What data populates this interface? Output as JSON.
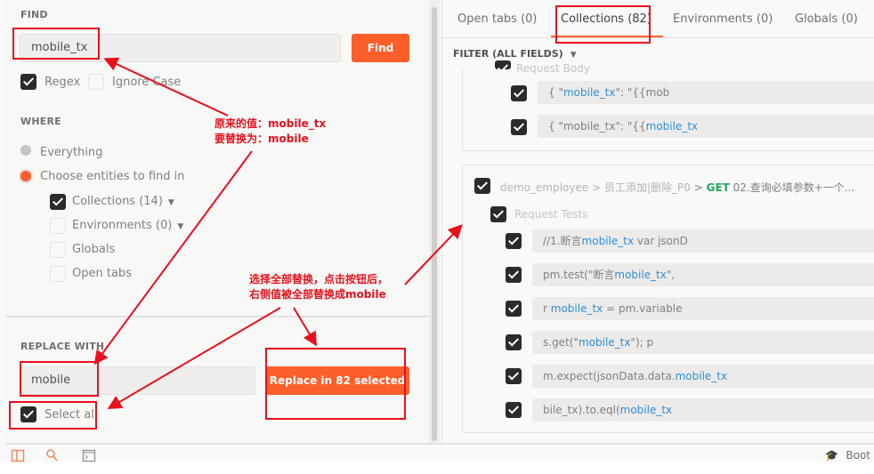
{
  "find": {
    "section_label": "FIND",
    "input_value": "mobile_tx",
    "find_button": "Find",
    "regex_label": "Regex",
    "regex_checked": true,
    "ignore_case_label": "Ignore Case",
    "ignore_case_checked": false
  },
  "where": {
    "section_label": "WHERE",
    "everything_label": "Everything",
    "choose_label": "Choose entities to find in",
    "selected_option": "Choose entities to find in",
    "entities": [
      {
        "label": "Collections (14)",
        "checked": true,
        "has_dropdown": true
      },
      {
        "label": "Environments (0)",
        "checked": false,
        "has_dropdown": true
      },
      {
        "label": "Globals",
        "checked": false,
        "has_dropdown": false
      },
      {
        "label": "Open tabs",
        "checked": false,
        "has_dropdown": false
      }
    ]
  },
  "replace": {
    "section_label": "REPLACE WITH",
    "input_value": "mobile",
    "select_all_label": "Select all",
    "select_all_checked": true,
    "replace_button": "Replace in 82 selected"
  },
  "results": {
    "tabs": [
      {
        "label": "Open tabs (0)",
        "active": false
      },
      {
        "label": "Collections (82)",
        "active": true
      },
      {
        "label": "Environments (0)",
        "active": false
      },
      {
        "label": "Globals (0)",
        "active": false
      }
    ],
    "filter_label": "FILTER (ALL FIELDS)",
    "group1": {
      "section_label": "Request Body",
      "rows": [
        {
          "pre": "{ \"",
          "match": "mobile_tx",
          "post": "\": \"{{mob"
        },
        {
          "pre": "{ \"mobile_tx\": \"{{",
          "match": "mobile_tx",
          "post": ""
        }
      ]
    },
    "group2": {
      "breadcrumb_collection": "demo_employee",
      "breadcrumb_folder": "员工添加|删除_P0",
      "method": "GET",
      "request_name": "02.查询必填参数+一个...",
      "section_label": "Request Tests",
      "rows": [
        {
          "pre": "//1.断言",
          "match": "mobile_tx",
          "post": " var jsonD"
        },
        {
          "pre": "pm.test(\"断言",
          "match": "mobile_tx",
          "post": "\","
        },
        {
          "pre": "r ",
          "match": "mobile_tx",
          "post": " = pm.variable"
        },
        {
          "pre": "s.get(\"",
          "match": "mobile_tx",
          "post": "\"); p"
        },
        {
          "pre": "m.expect(jsonData.data.",
          "match": "mobile_tx",
          "post": ""
        },
        {
          "pre": "bile_tx).to.eql(",
          "match": "mobile_tx",
          "post": ""
        }
      ]
    }
  },
  "statusbar": {
    "bootcamp_label": "Boot"
  },
  "annotations": {
    "note1_line1": "原来的值：mobile_tx",
    "note1_line2": "要替换为：mobile",
    "note2_line1": "选择全部替换，点击按钮后，",
    "note2_line2": "右侧值被全部替换成mobile"
  },
  "colors": {
    "accent": "#fd5f2a",
    "match_highlight": "#2e8ed8",
    "method_get": "#26a65b",
    "annotation": "#e8101c"
  }
}
